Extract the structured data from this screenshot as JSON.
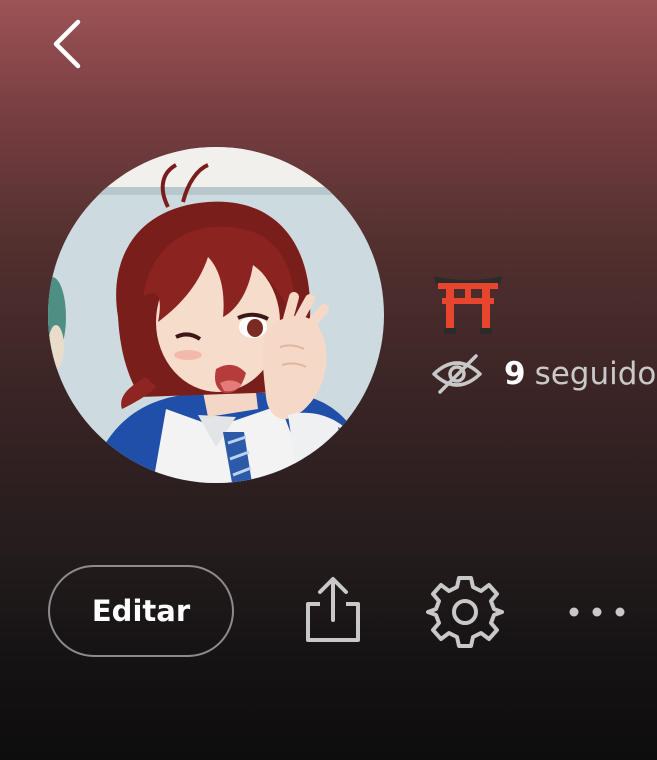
{
  "header": {
    "back_icon": "chevron-left-icon"
  },
  "profile": {
    "avatar": "anime-character-avatar",
    "emoji": "⛩️",
    "visibility_icon": "eye-off-icon",
    "followers_count": "9",
    "followers_label": "seguido"
  },
  "actions": {
    "edit_label": "Editar",
    "share_icon": "share-icon",
    "settings_icon": "gear-icon",
    "more_icon": "more-horizontal-icon"
  },
  "colors": {
    "gradient_top": "#9c5456",
    "gradient_bottom": "#0e0d0e",
    "text_primary": "#ffffff",
    "text_secondary": "#c9c9c9",
    "button_border": "#8d8b8b",
    "icon_gray": "#c8c8c8"
  }
}
